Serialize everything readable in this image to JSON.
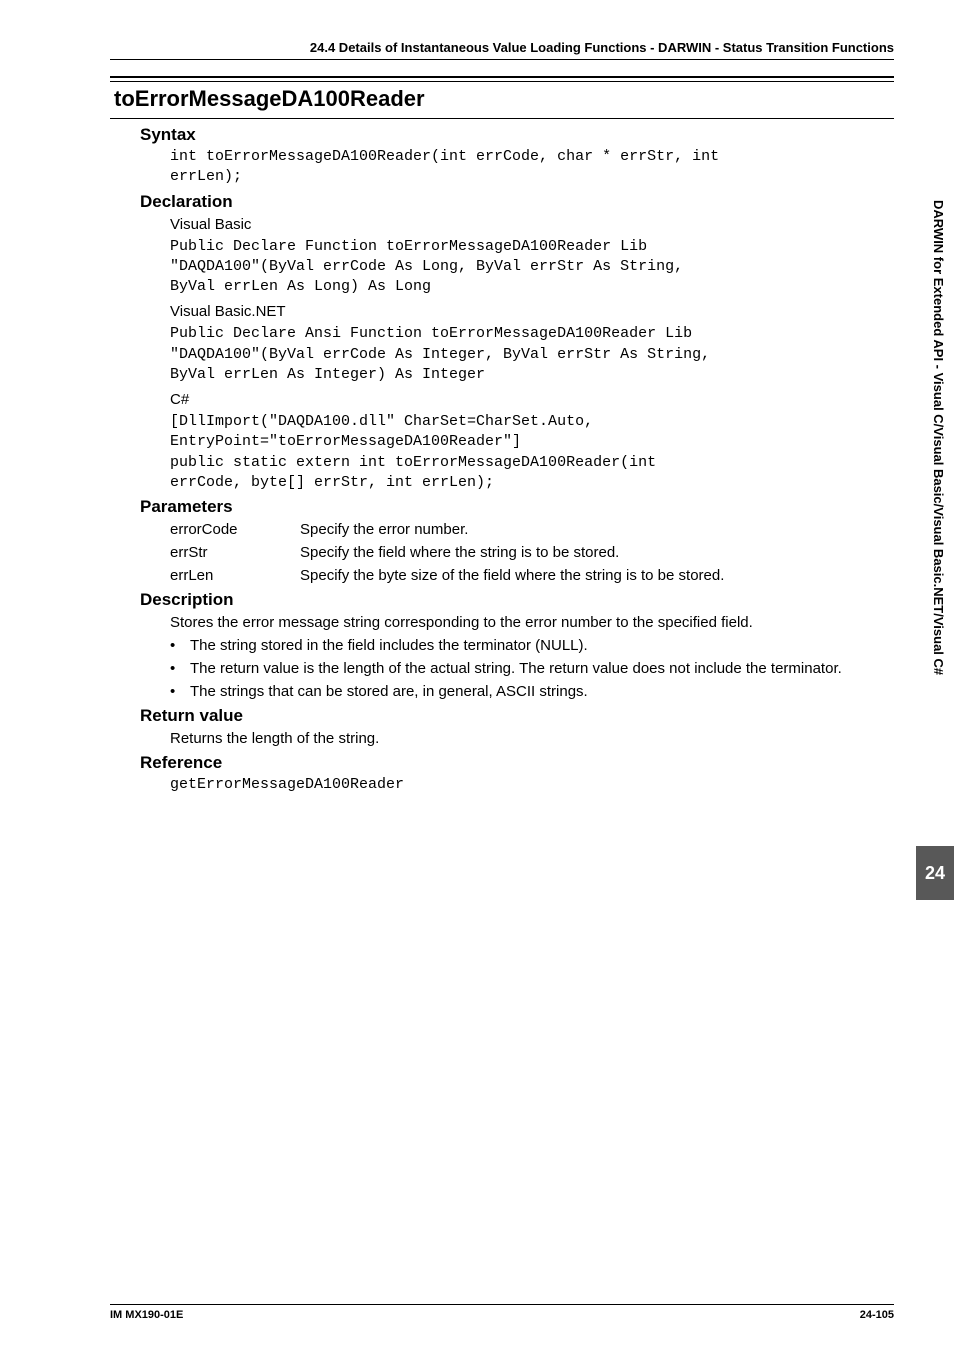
{
  "header": {
    "running": "24.4  Details of Instantaneous Value Loading Functions - DARWIN - Status Transition Functions"
  },
  "title": "toErrorMessageDA100Reader",
  "syntax": {
    "heading": "Syntax",
    "code": "int toErrorMessageDA100Reader(int errCode, char * errStr, int\nerrLen);"
  },
  "declaration": {
    "heading": "Declaration",
    "vb_label": "Visual Basic",
    "vb_code": "Public Declare Function toErrorMessageDA100Reader Lib\n\"DAQDA100\"(ByVal errCode As Long, ByVal errStr As String,\nByVal errLen As Long) As Long",
    "vbnet_label": "Visual Basic.NET",
    "vbnet_code": "Public Declare Ansi Function toErrorMessageDA100Reader Lib\n\"DAQDA100\"(ByVal errCode As Integer, ByVal errStr As String,\nByVal errLen As Integer) As Integer",
    "cs_label": "C#",
    "cs_code": "[DllImport(\"DAQDA100.dll\" CharSet=CharSet.Auto,\nEntryPoint=\"toErrorMessageDA100Reader\"]\npublic static extern int toErrorMessageDA100Reader(int\nerrCode, byte[] errStr, int errLen);"
  },
  "parameters": {
    "heading": "Parameters",
    "rows": [
      {
        "name": "errorCode",
        "desc": "Specify the error number."
      },
      {
        "name": "errStr",
        "desc": "Specify the field where the string is to be stored."
      },
      {
        "name": "errLen",
        "desc": "Specify the byte size of the field where the string is to be stored."
      }
    ]
  },
  "description": {
    "heading": "Description",
    "intro": "Stores the error message string corresponding to the error number to the specified field.",
    "bullets": [
      "The string stored in the field includes the terminator (NULL).",
      "The return value is the length of the actual string.  The return value does not include the terminator.",
      "The strings that can be stored are, in general, ASCII strings."
    ]
  },
  "retval": {
    "heading": "Return value",
    "text": "Returns the length of the string."
  },
  "reference": {
    "heading": "Reference",
    "code": "getErrorMessageDA100Reader"
  },
  "sidebar": {
    "label": "DARWIN for Extended API - Visual C/Visual Basic/Visual Basic.NET/Visual C#",
    "chapter": "24"
  },
  "footer": {
    "left": "IM MX190-01E",
    "right": "24-105"
  }
}
